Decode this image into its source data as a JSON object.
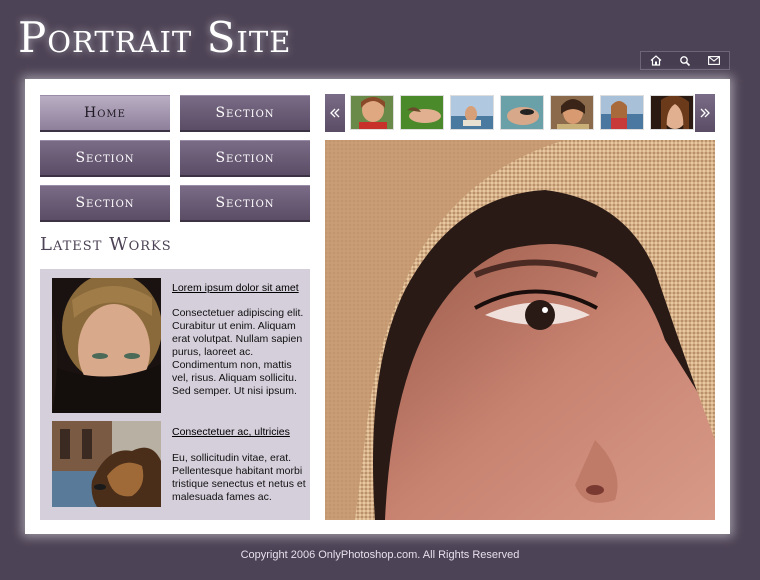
{
  "site": {
    "title": "Portrait Site"
  },
  "top_icons": [
    {
      "name": "home-icon"
    },
    {
      "name": "search-icon"
    },
    {
      "name": "mail-icon"
    }
  ],
  "nav": [
    {
      "label": "Home",
      "active": true
    },
    {
      "label": "Section",
      "active": false
    },
    {
      "label": "Section",
      "active": false
    },
    {
      "label": "Section",
      "active": false
    },
    {
      "label": "Section",
      "active": false
    },
    {
      "label": "Section",
      "active": false
    }
  ],
  "latest": {
    "heading": "Latest Works",
    "items": [
      {
        "title": "Lorem ipsum dolor sit amet",
        "text": "Consectetuer adipiscing elit. Curabitur ut enim. Aliquam erat volutpat. Nullam sapien purus, laoreet ac. Condimentum non, mattis vel, risus. Aliquam sollicitu. Sed semper. Ut nisi ipsum."
      },
      {
        "title": "Consectetuer ac, ultricies",
        "text": "Eu, sollicitudin vitae, erat. Pellentesque habitant morbi tristique senectus et netus et malesuada fames ac."
      }
    ]
  },
  "footer": {
    "text": "Copyright 2006 OnlyPhotoshop.com. All Rights Reserved"
  },
  "colors": {
    "page_bg": "#4d4356",
    "button": "#6a5b76",
    "button_active": "#a89bb4",
    "panel": "#d5cfdb"
  }
}
